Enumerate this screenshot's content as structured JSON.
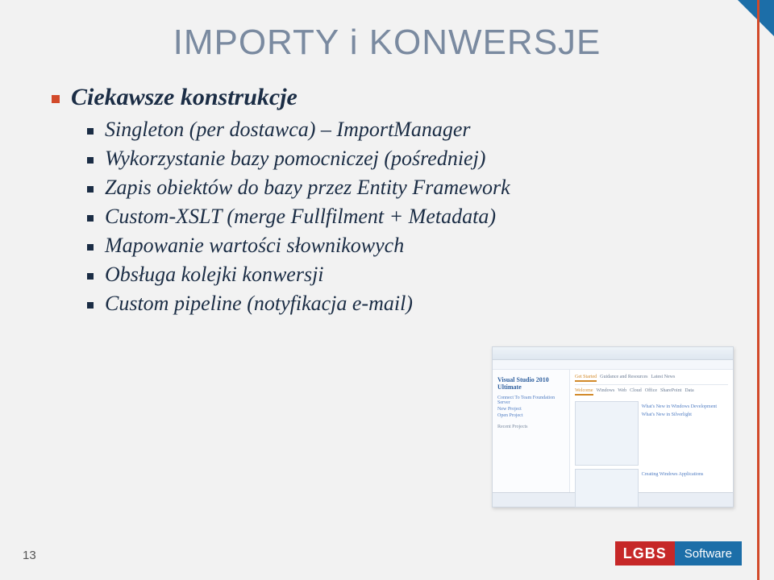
{
  "title": "IMPORTY i KONWERSJE",
  "heading1": "Ciekawsze konstrukcje",
  "items": [
    "Singleton (per dostawca) – ImportManager",
    "Wykorzystanie bazy pomocniczej (pośredniej)",
    "Zapis obiektów do bazy przez Entity Framework",
    "Custom-XSLT (merge Fullfilment + Metadata)",
    "Mapowanie wartości słownikowych",
    "Obsługa kolejki konwersji",
    "Custom pipeline (notyfikacja e-mail)"
  ],
  "screenshot": {
    "brand": "Visual Studio 2010 Ultimate",
    "side_links": [
      "Connect To Team Foundation Server",
      "New Project",
      "Open Project"
    ],
    "recent_header": "Recent Projects",
    "tabs": [
      "Get Started",
      "Guidance and Resources",
      "Latest News"
    ],
    "tab_row": [
      "Welcome",
      "Windows",
      "Web",
      "Cloud",
      "Office",
      "SharePoint",
      "Data"
    ],
    "captions": [
      "What's New in Windows Development",
      "What's New in Silverlight",
      "Creating Windows Applications"
    ]
  },
  "page_number": "13",
  "logo": {
    "left": "LGBS",
    "right": "Software"
  }
}
